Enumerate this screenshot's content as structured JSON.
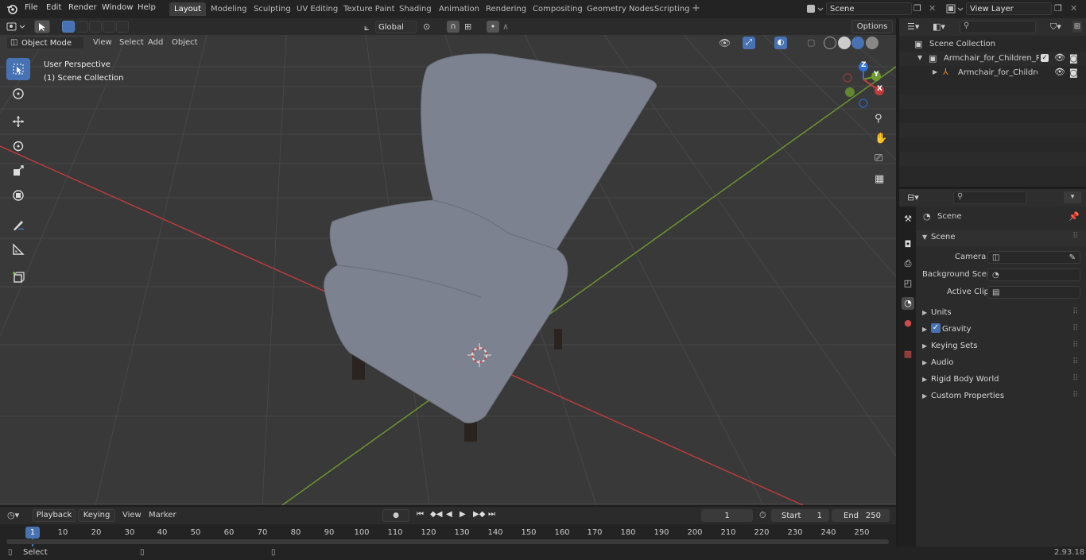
{
  "menu": {
    "file": "File",
    "edit": "Edit",
    "render": "Render",
    "window": "Window",
    "help": "Help"
  },
  "workspaces": [
    "Layout",
    "Modeling",
    "Sculpting",
    "UV Editing",
    "Texture Paint",
    "Shading",
    "Animation",
    "Rendering",
    "Compositing",
    "Geometry Nodes",
    "Scripting"
  ],
  "scene_field": "Scene",
  "view_layer_field": "View Layer",
  "viewport_header": {
    "mode": "Object Mode",
    "view": "View",
    "select": "Select",
    "add": "Add",
    "object": "Object",
    "transform": "Global",
    "options": "Options"
  },
  "viewport_overlay": {
    "perspective": "User Perspective",
    "collection": "(1) Scene Collection"
  },
  "gizmo": {
    "z": "Z",
    "y": "Y",
    "x": "X"
  },
  "outliner": {
    "root": "Scene Collection",
    "items": [
      {
        "label": "Armchair_for_Children_Room"
      },
      {
        "label": "Armchair_for_Children_R"
      }
    ]
  },
  "properties": {
    "title": "Scene",
    "section": "Scene",
    "camera_label": "Camera",
    "background_scene_label": "Background Scene",
    "active_clip_label": "Active Clip",
    "subsections": [
      "Units",
      "Gravity",
      "Keying Sets",
      "Audio",
      "Rigid Body World",
      "Custom Properties"
    ],
    "gravity_checked": true
  },
  "timeline": {
    "playback": "Playback",
    "keying": "Keying",
    "view": "View",
    "marker": "Marker",
    "current_frame": "1",
    "start_label": "Start",
    "start_value": "1",
    "end_label": "End",
    "end_value": "250",
    "ticks": [
      "1",
      "10",
      "20",
      "30",
      "40",
      "50",
      "60",
      "70",
      "80",
      "90",
      "100",
      "110",
      "120",
      "130",
      "140",
      "150",
      "160",
      "170",
      "180",
      "190",
      "200",
      "210",
      "220",
      "230",
      "240",
      "250"
    ]
  },
  "status": {
    "select": "Select",
    "version": "2.93.18"
  },
  "colors": {
    "accent": "#4772b3",
    "x_axis": "#c33c3c",
    "y_axis": "#6e9a2f",
    "z_axis": "#2f6fd6",
    "chair": "#7d8290"
  }
}
